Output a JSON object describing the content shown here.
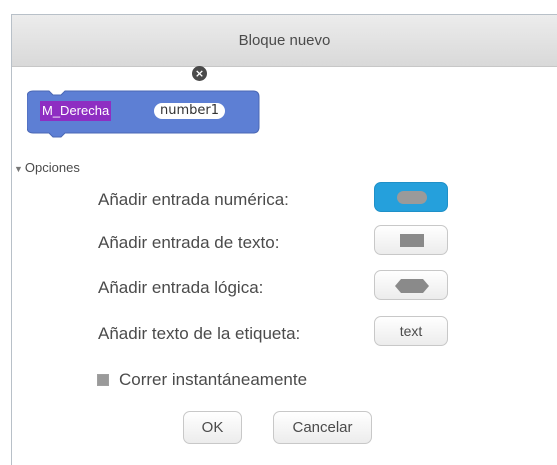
{
  "dialog": {
    "title": "Bloque nuevo"
  },
  "block": {
    "name": "M_Derecha",
    "argument": "number1",
    "color": "#8e2ec2"
  },
  "options": {
    "toggle_label": "Opciones",
    "numeric_label": "Añadir entrada numérica:",
    "text_label": "Añadir entrada de texto:",
    "boolean_label": "Añadir entrada lógica:",
    "label_label": "Añadir texto de la etiqueta:",
    "label_button_text": "text",
    "run_instantly_label": "Correr instantáneamente",
    "run_instantly_checked": false
  },
  "buttons": {
    "ok": "OK",
    "cancel": "Cancelar"
  },
  "colors": {
    "active_input": "#25a0dc",
    "block": "#8e2ec2"
  }
}
